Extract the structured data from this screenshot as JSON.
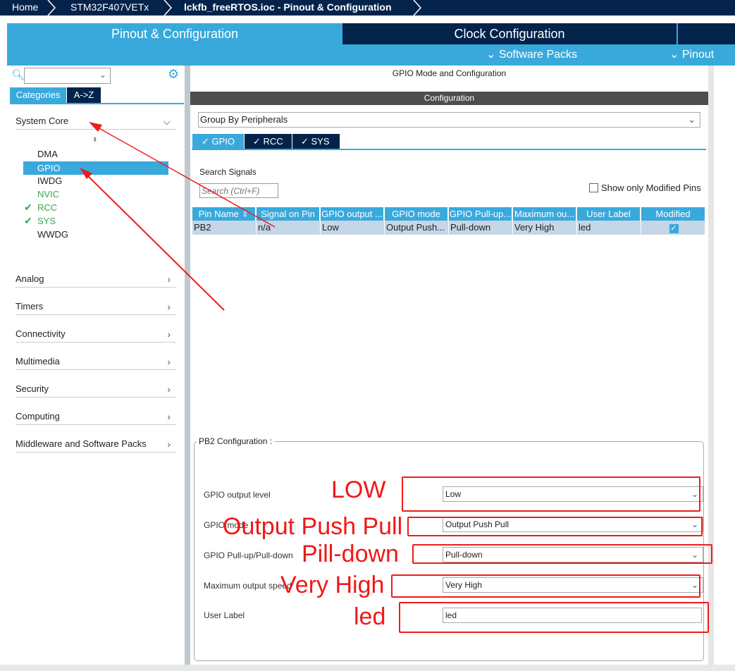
{
  "breadcrumb": [
    "Home",
    "STM32F407VETx",
    "lckfb_freeRTOS.ioc - Pinout & Configuration"
  ],
  "tabs": {
    "pinout": "Pinout & Configuration",
    "clock": "Clock Configuration",
    "software_packs": "Software Packs",
    "pinout_menu": "Pinout"
  },
  "left": {
    "tab_categories": "Categories",
    "tab_az": "A->Z",
    "categories": [
      "System Core",
      "Analog",
      "Timers",
      "Connectivity",
      "Multimedia",
      "Security",
      "Computing",
      "Middleware and Software Packs"
    ],
    "system_core_items": [
      {
        "label": "DMA",
        "status": ""
      },
      {
        "label": "GPIO",
        "status": "selected"
      },
      {
        "label": "IWDG",
        "status": ""
      },
      {
        "label": "NVIC",
        "status": "configured"
      },
      {
        "label": "RCC",
        "status": "ok"
      },
      {
        "label": "SYS",
        "status": "ok"
      },
      {
        "label": "WWDG",
        "status": ""
      }
    ]
  },
  "right": {
    "header": "GPIO Mode and Configuration",
    "config_title": "Configuration",
    "group_by": "Group By Peripherals",
    "ptabs": [
      "GPIO",
      "RCC",
      "SYS"
    ],
    "search_label": "Search Signals",
    "search_placeholder": "Search (Ctrl+F)",
    "show_modified": "Show only Modified Pins",
    "columns": [
      "Pin Name",
      "Signal on Pin",
      "GPIO output ...",
      "GPIO mode",
      "GPIO Pull-up...",
      "Maximum ou...",
      "User Label",
      "Modified"
    ],
    "row": [
      "PB2",
      "n/a",
      "Low",
      "Output Push...",
      "Pull-down",
      "Very High",
      "led"
    ],
    "row_modified": true,
    "pin_config_title": "PB2 Configuration :",
    "fields": [
      {
        "label": "GPIO output level",
        "value": "Low"
      },
      {
        "label": "GPIO mode",
        "value": "Output Push Pull"
      },
      {
        "label": "GPIO Pull-up/Pull-down",
        "value": "Pull-down"
      },
      {
        "label": "Maximum output speed",
        "value": "Very High"
      },
      {
        "label": "User Label",
        "value": "led"
      }
    ]
  },
  "annotations": [
    "LOW",
    "Output Push Pull",
    "Pill-down",
    "Very High",
    "led"
  ],
  "colors": {
    "navy": "#03234b",
    "blue": "#39a9dc",
    "annotation": "#ee1c1c"
  }
}
